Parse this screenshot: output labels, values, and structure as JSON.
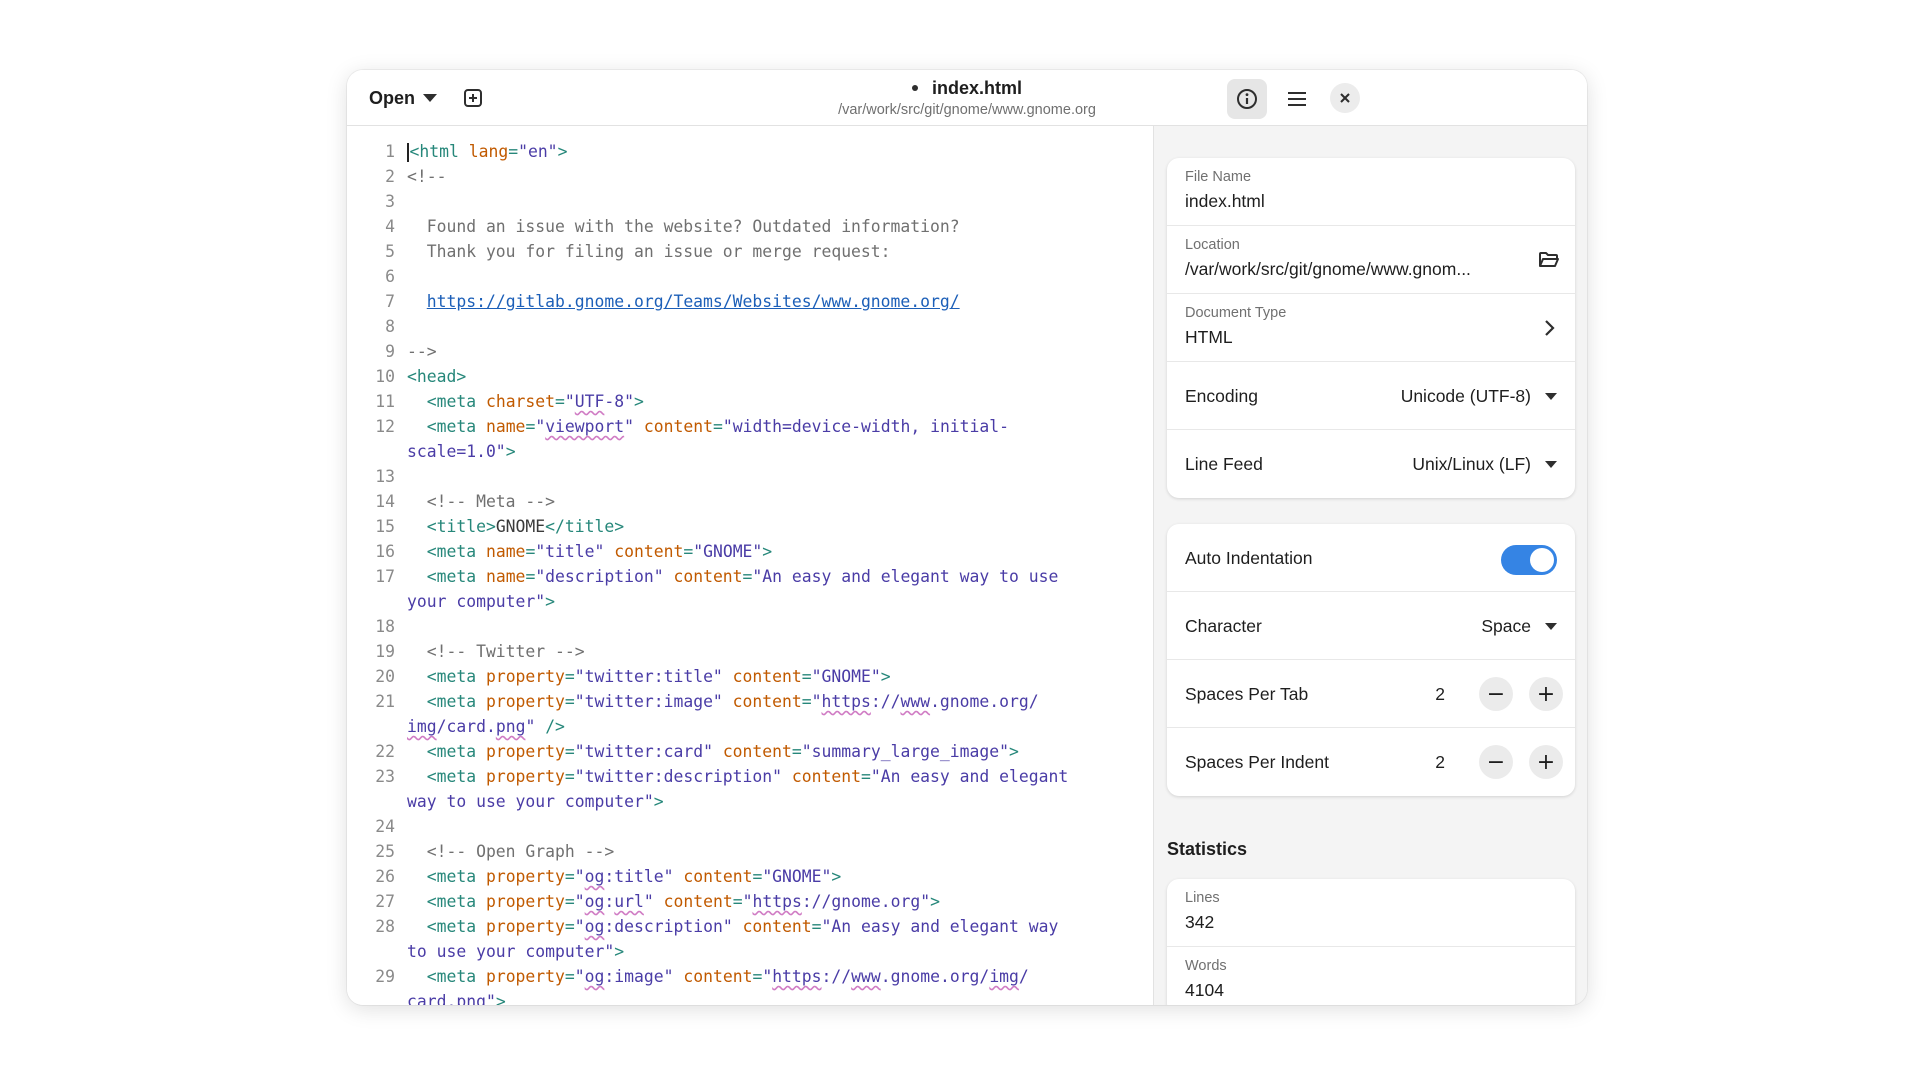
{
  "header": {
    "open_label": "Open",
    "title": "index.html",
    "subtitle": "/var/work/src/git/gnome/www.gnome.org"
  },
  "icons": {
    "new_tab": "new-tab-icon",
    "info": "info-icon",
    "menu": "hamburger-menu-icon",
    "close": "close-icon",
    "open_folder": "open-folder-icon",
    "chevron": "chevron-right-icon"
  },
  "editor": {
    "line_numbers": [
      "1",
      "2",
      "3",
      "4",
      "5",
      "6",
      "7",
      "8",
      "9",
      "10",
      "11",
      "12",
      "",
      "13",
      "14",
      "15",
      "16",
      "17",
      "",
      "18",
      "19",
      "20",
      "21",
      "",
      "22",
      "23",
      "",
      "24",
      "25",
      "26",
      "27",
      "28",
      "",
      "29",
      ""
    ],
    "lines": [
      [
        [
          "tag",
          "<html "
        ],
        [
          "attr",
          "lang"
        ],
        [
          "tag",
          "="
        ],
        [
          "str",
          "\"en\""
        ],
        [
          "tag",
          ">"
        ]
      ],
      [
        [
          "cmt",
          "<!--"
        ]
      ],
      [],
      [
        [
          "cmt",
          "  Found an issue with the website? Outdated information?"
        ]
      ],
      [
        [
          "cmt",
          "  Thank you for filing an issue or merge request:"
        ]
      ],
      [],
      [
        [
          "cmt",
          "  "
        ],
        [
          "url",
          "https://gitlab.gnome.org/Teams/Websites/www.gnome.org/"
        ]
      ],
      [],
      [
        [
          "cmt",
          "-->"
        ]
      ],
      [
        [
          "tag",
          "<head>"
        ]
      ],
      [
        [
          "tag",
          "  <meta "
        ],
        [
          "attr",
          "charset"
        ],
        [
          "tag",
          "="
        ],
        [
          "str",
          "\""
        ],
        [
          "str ul",
          "UTF"
        ],
        [
          "str",
          "-8\""
        ],
        [
          "tag",
          ">"
        ]
      ],
      [
        [
          "tag",
          "  <meta "
        ],
        [
          "attr",
          "name"
        ],
        [
          "tag",
          "="
        ],
        [
          "str",
          "\""
        ],
        [
          "str ul",
          "viewport"
        ],
        [
          "str",
          "\" "
        ],
        [
          "attr",
          "content"
        ],
        [
          "tag",
          "="
        ],
        [
          "str",
          "\"width=device-width, initial-"
        ]
      ],
      [
        [
          "str",
          "scale=1.0\""
        ],
        [
          "tag",
          ">"
        ]
      ],
      [],
      [
        [
          "cmt",
          "  <!-- Meta -->"
        ]
      ],
      [
        [
          "tag",
          "  <title>"
        ],
        [
          "plain",
          "GNOME"
        ],
        [
          "tag",
          "</title>"
        ]
      ],
      [
        [
          "tag",
          "  <meta "
        ],
        [
          "attr",
          "name"
        ],
        [
          "tag",
          "="
        ],
        [
          "str",
          "\"title\" "
        ],
        [
          "attr",
          "content"
        ],
        [
          "tag",
          "="
        ],
        [
          "str",
          "\"GNOME\""
        ],
        [
          "tag",
          ">"
        ]
      ],
      [
        [
          "tag",
          "  <meta "
        ],
        [
          "attr",
          "name"
        ],
        [
          "tag",
          "="
        ],
        [
          "str",
          "\"description\" "
        ],
        [
          "attr",
          "content"
        ],
        [
          "tag",
          "="
        ],
        [
          "str",
          "\"An easy and elegant way to use"
        ]
      ],
      [
        [
          "str",
          "your computer\""
        ],
        [
          "tag",
          ">"
        ]
      ],
      [],
      [
        [
          "cmt",
          "  <!-- Twitter -->"
        ]
      ],
      [
        [
          "tag",
          "  <meta "
        ],
        [
          "attr",
          "property"
        ],
        [
          "tag",
          "="
        ],
        [
          "str",
          "\"twitter:title\" "
        ],
        [
          "attr",
          "content"
        ],
        [
          "tag",
          "="
        ],
        [
          "str",
          "\"GNOME\""
        ],
        [
          "tag",
          ">"
        ]
      ],
      [
        [
          "tag",
          "  <meta "
        ],
        [
          "attr",
          "property"
        ],
        [
          "tag",
          "="
        ],
        [
          "str",
          "\"twitter:image\" "
        ],
        [
          "attr",
          "content"
        ],
        [
          "tag",
          "="
        ],
        [
          "str",
          "\""
        ],
        [
          "str ul",
          "https"
        ],
        [
          "str",
          "://"
        ],
        [
          "str ul",
          "www"
        ],
        [
          "str",
          ".gnome.org/"
        ]
      ],
      [
        [
          "str ul",
          "img"
        ],
        [
          "str",
          "/card."
        ],
        [
          "str ul",
          "png"
        ],
        [
          "str",
          "\" "
        ],
        [
          "tag",
          "/>"
        ]
      ],
      [
        [
          "tag",
          "  <meta "
        ],
        [
          "attr",
          "property"
        ],
        [
          "tag",
          "="
        ],
        [
          "str",
          "\"twitter:card\" "
        ],
        [
          "attr",
          "content"
        ],
        [
          "tag",
          "="
        ],
        [
          "str",
          "\"summary_large_image\""
        ],
        [
          "tag",
          ">"
        ]
      ],
      [
        [
          "tag",
          "  <meta "
        ],
        [
          "attr",
          "property"
        ],
        [
          "tag",
          "="
        ],
        [
          "str",
          "\"twitter:description\" "
        ],
        [
          "attr",
          "content"
        ],
        [
          "tag",
          "="
        ],
        [
          "str",
          "\"An easy and elegant"
        ]
      ],
      [
        [
          "str",
          "way to use your computer\""
        ],
        [
          "tag",
          ">"
        ]
      ],
      [],
      [
        [
          "cmt",
          "  <!-- Open Graph -->"
        ]
      ],
      [
        [
          "tag",
          "  <meta "
        ],
        [
          "attr",
          "property"
        ],
        [
          "tag",
          "="
        ],
        [
          "str",
          "\""
        ],
        [
          "str ul",
          "og"
        ],
        [
          "str",
          ":title\" "
        ],
        [
          "attr",
          "content"
        ],
        [
          "tag",
          "="
        ],
        [
          "str",
          "\"GNOME\""
        ],
        [
          "tag",
          ">"
        ]
      ],
      [
        [
          "tag",
          "  <meta "
        ],
        [
          "attr",
          "property"
        ],
        [
          "tag",
          "="
        ],
        [
          "str",
          "\""
        ],
        [
          "str ul",
          "og"
        ],
        [
          "str",
          ":"
        ],
        [
          "str ul",
          "url"
        ],
        [
          "str",
          "\" "
        ],
        [
          "attr",
          "content"
        ],
        [
          "tag",
          "="
        ],
        [
          "str",
          "\""
        ],
        [
          "str ul",
          "https"
        ],
        [
          "str",
          "://gnome.org\""
        ],
        [
          "tag",
          ">"
        ]
      ],
      [
        [
          "tag",
          "  <meta "
        ],
        [
          "attr",
          "property"
        ],
        [
          "tag",
          "="
        ],
        [
          "str",
          "\""
        ],
        [
          "str ul",
          "og"
        ],
        [
          "str",
          ":description\" "
        ],
        [
          "attr",
          "content"
        ],
        [
          "tag",
          "="
        ],
        [
          "str",
          "\"An easy and elegant way"
        ]
      ],
      [
        [
          "str",
          "to use your computer\""
        ],
        [
          "tag",
          ">"
        ]
      ],
      [
        [
          "tag",
          "  <meta "
        ],
        [
          "attr",
          "property"
        ],
        [
          "tag",
          "="
        ],
        [
          "str",
          "\""
        ],
        [
          "str ul",
          "og"
        ],
        [
          "str",
          ":image\" "
        ],
        [
          "attr",
          "content"
        ],
        [
          "tag",
          "="
        ],
        [
          "str",
          "\""
        ],
        [
          "str ul",
          "https"
        ],
        [
          "str",
          "://"
        ],
        [
          "str ul",
          "www"
        ],
        [
          "str",
          ".gnome.org/"
        ],
        [
          "str ul",
          "img"
        ],
        [
          "str",
          "/"
        ]
      ],
      [
        [
          "str",
          "card.png\""
        ],
        [
          "tag",
          ">"
        ]
      ]
    ]
  },
  "file_info": {
    "file_name_label": "File Name",
    "file_name": "index.html",
    "location_label": "Location",
    "location": "/var/work/src/git/gnome/www.gnom...",
    "doc_type_label": "Document Type",
    "doc_type": "HTML",
    "encoding_label": "Encoding",
    "encoding_value": "Unicode (UTF-8)",
    "line_feed_label": "Line Feed",
    "line_feed_value": "Unix/Linux (LF)"
  },
  "indent": {
    "auto_label": "Auto Indentation",
    "auto_enabled": true,
    "character_label": "Character",
    "character_value": "Space",
    "spaces_per_tab_label": "Spaces Per Tab",
    "spaces_per_tab": "2",
    "spaces_per_indent_label": "Spaces Per Indent",
    "spaces_per_indent": "2",
    "minus": "−",
    "plus": "+"
  },
  "statistics": {
    "title": "Statistics",
    "lines_label": "Lines",
    "lines": "342",
    "words_label": "Words",
    "words": "4104"
  },
  "colors": {
    "accent": "#3584e4",
    "tag": "#26877a",
    "attribute": "#c15a00",
    "string": "#4a3ca6",
    "comment": "#707070",
    "link": "#1c5fb8"
  }
}
